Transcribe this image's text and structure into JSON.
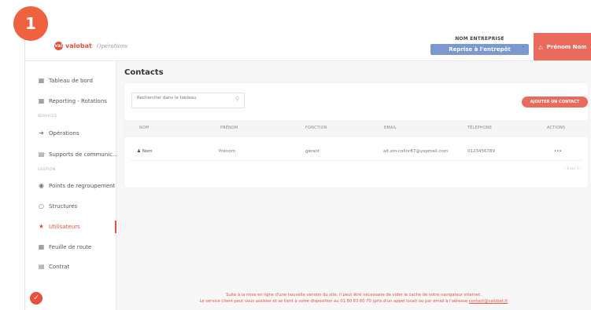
{
  "step": "1",
  "brand": {
    "logo_text": "val",
    "name": "valobat",
    "sub": "Opérations"
  },
  "company": {
    "name": "NOM ENTREPRISE",
    "action": "Reprise à l'entrepôt"
  },
  "user": {
    "label": "Prénom Nom"
  },
  "sidebar": {
    "items": [
      {
        "label": "Tableau de bord",
        "icon": "dashboard-icon"
      },
      {
        "label": "Reporting - Rotations",
        "icon": "reporting-icon"
      },
      {
        "label": "Opérations",
        "icon": "operations-icon"
      },
      {
        "label": "Supports de communic...",
        "icon": "supports-icon"
      },
      {
        "label": "Points de regroupement",
        "icon": "location-pin-icon"
      },
      {
        "label": "Structures",
        "icon": "structures-icon"
      },
      {
        "label": "Utilisateurs",
        "icon": "users-icon",
        "active": true
      },
      {
        "label": "Feuille de route",
        "icon": "roadmap-icon"
      },
      {
        "label": "Contrat",
        "icon": "contract-icon"
      }
    ],
    "sections": {
      "services": "SERVICES",
      "gestion": "GESTION"
    }
  },
  "page": {
    "title": "Contacts"
  },
  "search": {
    "placeholder": "Rechercher dans le tableau"
  },
  "add_button": "AJOUTER UN CONTACT",
  "table": {
    "headers": [
      "NOM",
      "PRÉNOM",
      "FONCTION",
      "EMAIL",
      "TÉLÉPHONE",
      "ACTIONS"
    ],
    "rows": [
      {
        "nom": "Nom",
        "prenom": "Prénom",
        "fonction": "gérant",
        "email": "alt.zm-collnr87@yopmail.com",
        "telephone": "0123456789",
        "actions": "•••"
      }
    ],
    "pager": "‹  1 sur 1  ›"
  },
  "footer": {
    "line1": "Suite à la mise en ligne d'une nouvelle version du site, il peut être nécessaire de vider le cache de votre navigateur internet.",
    "line2": "Le service client peut vous assister et se tient à votre disposition au 01 80 83 60 70 (prix d'un appel local) ou par email à l'adresse ",
    "email": "contact@valobat.fr"
  },
  "colors": {
    "accent": "#e8503a",
    "button": "#ea6a5c",
    "company_button": "#7b99cf"
  }
}
